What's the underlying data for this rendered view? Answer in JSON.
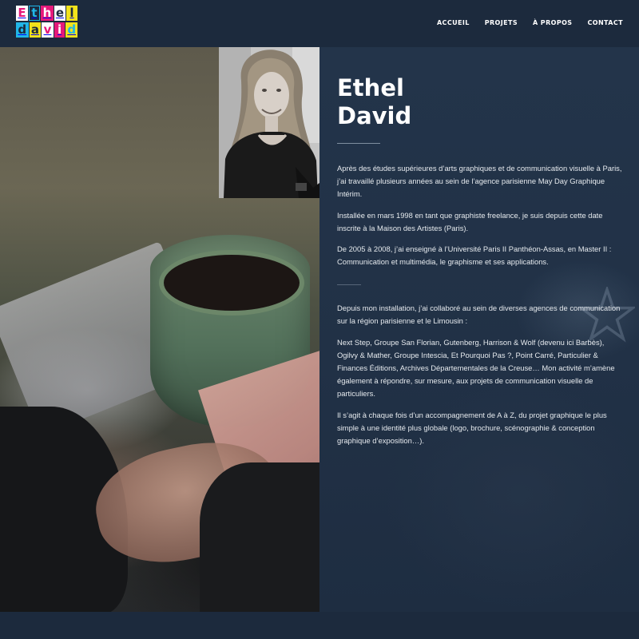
{
  "logo": {
    "letters_row1": [
      "E",
      "t",
      "h",
      "e",
      "l"
    ],
    "letters_row2": [
      "d",
      "a",
      "v",
      "i",
      "d"
    ],
    "colors": [
      "#e6197a",
      "#20b6e8",
      "#f2e21b",
      "#ffffff",
      "#1c2a3d"
    ]
  },
  "nav": {
    "items": [
      "ACCUEIL",
      "PROJETS",
      "À PROPOS",
      "CONTACT"
    ]
  },
  "main": {
    "title_line1": "Ethel",
    "title_line2": "David",
    "paragraphs": [
      "Après des études supérieures d’arts graphiques et de communication visuelle à Paris, j’ai travaillé plusieurs années au sein de l’agence parisienne May Day Graphique Intérim.",
      "Installée en mars 1998 en tant que graphiste freelance, je suis depuis cette date inscrite à la Maison des Artistes (Paris).",
      "De 2005 à 2008, j’ai enseigné à l’Université Paris II Panthéon-Assas, en Master II : Communication et multimédia, le graphisme et ses applications.",
      "Depuis mon installation, j’ai collaboré au sein de diverses agences de communication sur la région parisienne et le Limousin :",
      "Next Step, Groupe San Florian, Gutenberg, Harrison & Wolf (devenu ici Barbès), Ogilvy & Mather, Groupe Intescia, Et Pourquoi Pas ?, Point Carré, Particulier & Finances Éditions, Archives Départementales de la Creuse… Mon activité m’amène également à répondre, sur mesure, aux projets de communication visuelle de particuliers.",
      "Il s’agit à chaque fois d’un accompagnement de A à Z, du projet graphique le plus simple à une identité plus globale (logo, brochure, scénographie & conception graphique d’exposition…)."
    ]
  },
  "colors": {
    "header_bg": "#1c2a3d",
    "panel_bg": "#22334a",
    "text": "#ffffff"
  }
}
